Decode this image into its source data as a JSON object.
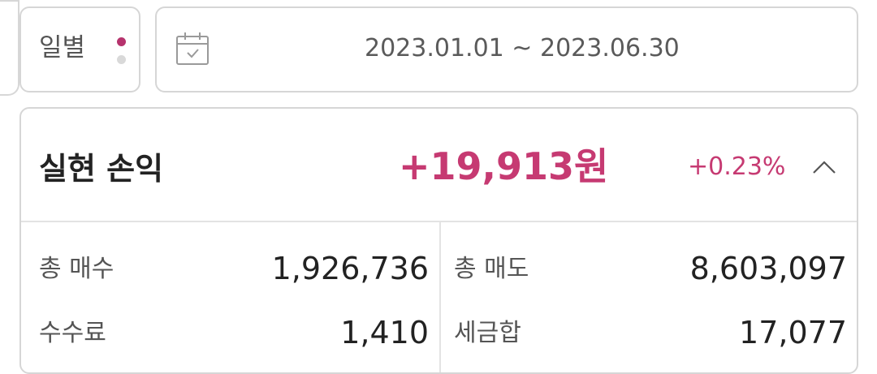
{
  "filter": {
    "period_label": "일별",
    "date_range": "2023.01.01 ~ 2023.06.30",
    "calendar_icon": "calendar-icon",
    "indicator_colors": {
      "active": "#b6336d",
      "inactive": "#d9d9d9"
    }
  },
  "summary": {
    "title": "실현 손익",
    "amount": "+19,913원",
    "rate": "+0.23%",
    "toggle_icon": "chevron-up-icon",
    "accent_color": "#c63a72",
    "stats": {
      "total_buy_label": "총 매수",
      "total_buy_value": "1,926,736",
      "total_sell_label": "총 매도",
      "total_sell_value": "8,603,097",
      "fee_label": "수수료",
      "fee_value": "1,410",
      "tax_label": "세금합",
      "tax_value": "17,077"
    }
  }
}
